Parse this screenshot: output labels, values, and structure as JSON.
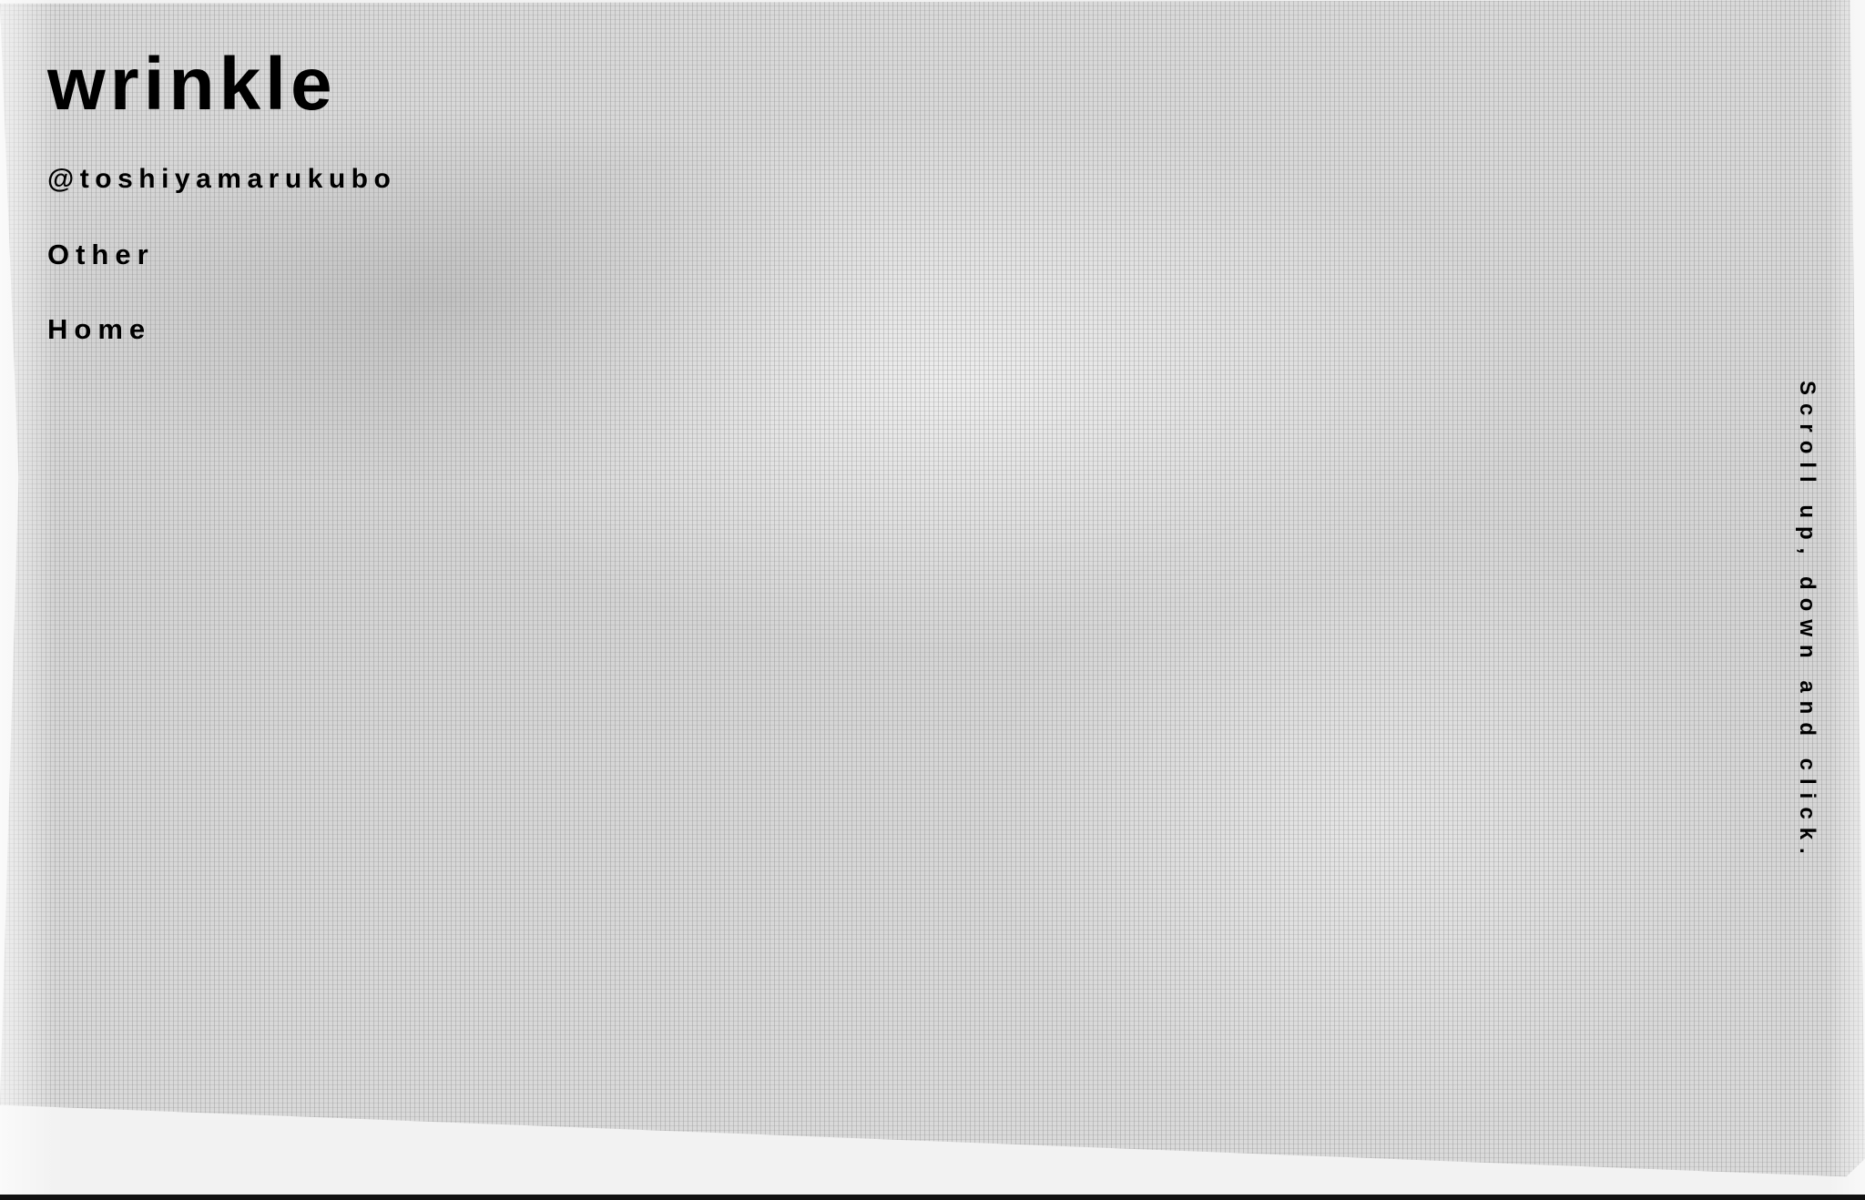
{
  "site": {
    "title": "wrinkle"
  },
  "nav": {
    "author_label": "@toshiyamarukubo",
    "other_label": "Other",
    "home_label": "Home"
  },
  "hint": {
    "text": "Scroll up, down and click."
  },
  "colors": {
    "text": "#000000",
    "mesh_background": "#d6d6d6",
    "page_background": "#f2f2f2",
    "bottom_bar": "#111111"
  }
}
